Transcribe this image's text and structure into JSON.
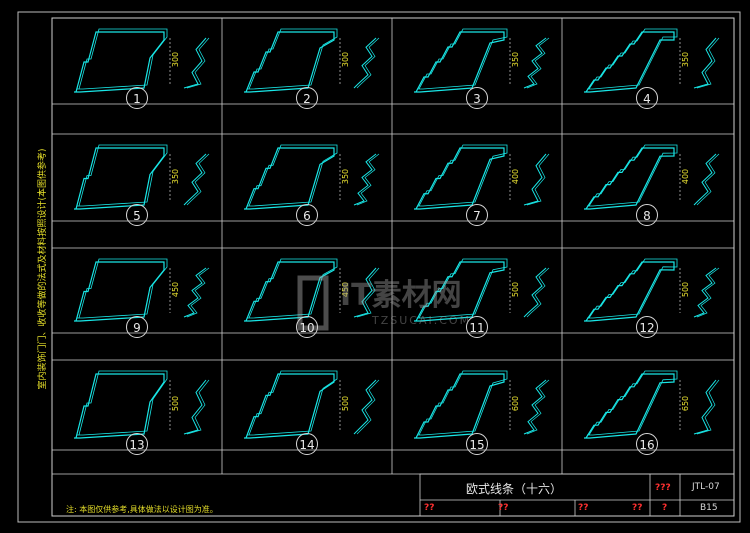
{
  "drawing": {
    "side_note": "室内装饰门门、收收等做的法式及材料按照设计(本图供参考)",
    "bottom_note": "注: 本图仅供参考,具体做法以设计图为准。",
    "title": "欧式线条（十六）",
    "code_label": "???",
    "code": "JTL-07",
    "page_label": "?",
    "page": "B15",
    "sign_labels": [
      "??",
      "??",
      "??",
      "??"
    ]
  },
  "profiles": [
    {
      "num": "1",
      "dim": "300"
    },
    {
      "num": "2",
      "dim": "300"
    },
    {
      "num": "3",
      "dim": "350"
    },
    {
      "num": "4",
      "dim": "350"
    },
    {
      "num": "5",
      "dim": "350"
    },
    {
      "num": "6",
      "dim": "350"
    },
    {
      "num": "7",
      "dim": "400"
    },
    {
      "num": "8",
      "dim": "400"
    },
    {
      "num": "9",
      "dim": "450"
    },
    {
      "num": "10",
      "dim": "450"
    },
    {
      "num": "11",
      "dim": "500"
    },
    {
      "num": "12",
      "dim": "500"
    },
    {
      "num": "13",
      "dim": "500"
    },
    {
      "num": "14",
      "dim": "500"
    },
    {
      "num": "15",
      "dim": "600"
    },
    {
      "num": "16",
      "dim": "650"
    }
  ],
  "watermark": {
    "brand": "IT素材网",
    "url": "TZSUCAI.COM"
  },
  "colors": {
    "profile": "#19e6e6",
    "frame": "#cfcfcf",
    "dimension": "#e8e030",
    "mark": "#ff3030"
  }
}
